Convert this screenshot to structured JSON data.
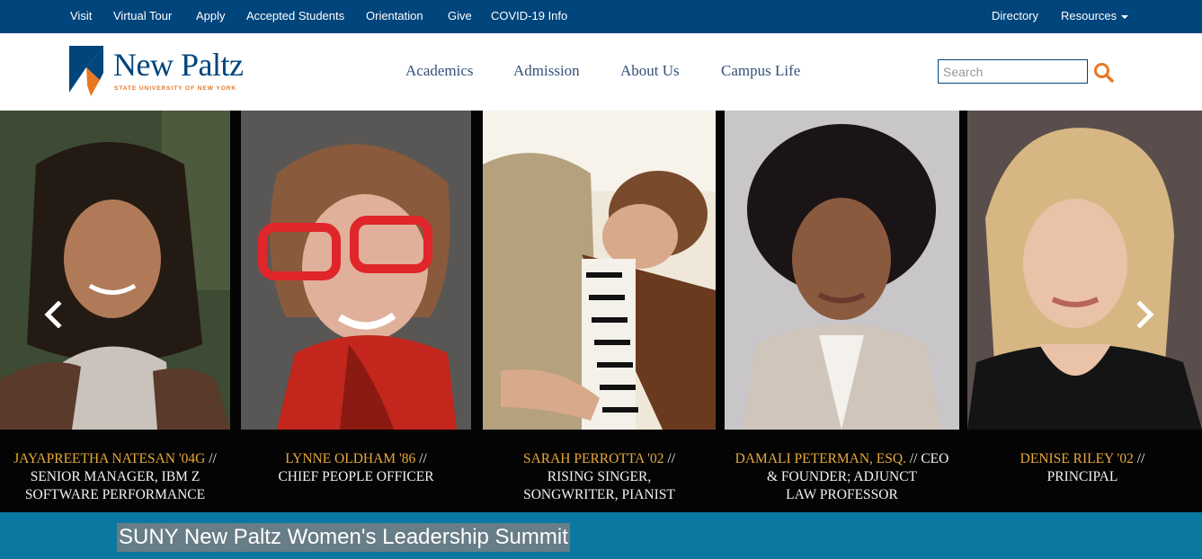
{
  "topbar": {
    "left_links": [
      "Visit",
      "Virtual Tour",
      "Apply",
      "Accepted Students",
      "Orientation",
      "Give",
      "COVID-19 Info"
    ],
    "right_links": [
      "Directory",
      "Resources"
    ]
  },
  "header": {
    "logo": {
      "name": "New Paltz",
      "subtitle": "STATE UNIVERSITY OF NEW YORK"
    },
    "nav": [
      "Academics",
      "Admission",
      "About Us",
      "Campus Life"
    ],
    "search": {
      "placeholder": "Search",
      "value": ""
    }
  },
  "carousel": {
    "prev_icon": "chevron-left-icon",
    "next_icon": "chevron-right-icon",
    "people": [
      {
        "name": "JAYAPREETHA  NATESAN '04G",
        "sep": "//",
        "lines": [
          "SENIOR MANAGER, IBM Z",
          "SOFTWARE PERFORMANCE"
        ]
      },
      {
        "name": "LYNNE OLDHAM '86",
        "sep": "//",
        "lines": [
          "CHIEF PEOPLE OFFICER"
        ]
      },
      {
        "name": "SARAH PERROTTA '02",
        "sep": "//",
        "lines": [
          "RISING SINGER,",
          "SONGWRITER, PIANIST"
        ]
      },
      {
        "name": "DAMALI PETERMAN, ESQ.",
        "sep": "// CEO",
        "lines": [
          "& FOUNDER; ADJUNCT",
          "LAW PROFESSOR"
        ]
      },
      {
        "name": "DENISE RILEY '02",
        "sep": "//",
        "lines": [
          "PRINCIPAL"
        ]
      }
    ]
  },
  "banner": {
    "title": "SUNY New Paltz Women's Leadership Summit"
  },
  "colors": {
    "navy": "#00457c",
    "orange": "#e87722",
    "teal": "#0b78a1",
    "gold": "#e8a93a"
  }
}
